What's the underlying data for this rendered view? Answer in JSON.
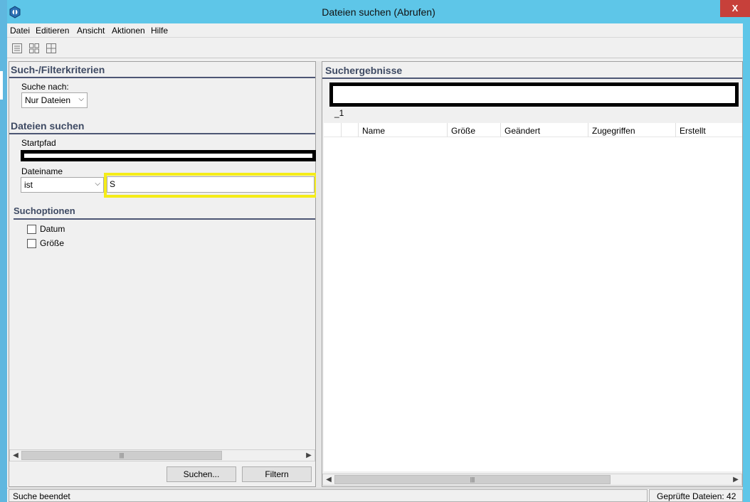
{
  "window": {
    "title": "Dateien suchen (Abrufen)",
    "close_label": "X"
  },
  "menu": [
    "Datei",
    "Editieren",
    "Ansicht",
    "Aktionen",
    "Hilfe"
  ],
  "toolbar": {
    "icons": [
      "list-view-icon",
      "grid-view-icon",
      "table-view-icon"
    ]
  },
  "left_pane": {
    "criteria_title": "Such-/Filterkriterien",
    "search_for_label": "Suche nach:",
    "search_for_value": "Nur Dateien",
    "find_files_title": "Dateien suchen",
    "start_path_label": "Startpfad",
    "filename_label": "Dateiname",
    "filename_operator": "ist",
    "filename_value": "S",
    "options_title": "Suchoptionen",
    "options": [
      "Datum",
      "Größe"
    ],
    "search_button": "Suchen...",
    "filter_button": "Filtern"
  },
  "right_pane": {
    "title": "Suchergebnisse",
    "tab_label": "_1",
    "columns": [
      "Name",
      "Größe",
      "Geändert",
      "Zugegriffen",
      "Erstellt"
    ]
  },
  "status": {
    "left": "Suche beendet",
    "right": "Geprüfte Dateien: 42"
  },
  "colors": {
    "titlebar": "#5ec6e8",
    "close": "#c7403a",
    "section_title": "#3e4a63",
    "highlight": "#f5ec19"
  }
}
